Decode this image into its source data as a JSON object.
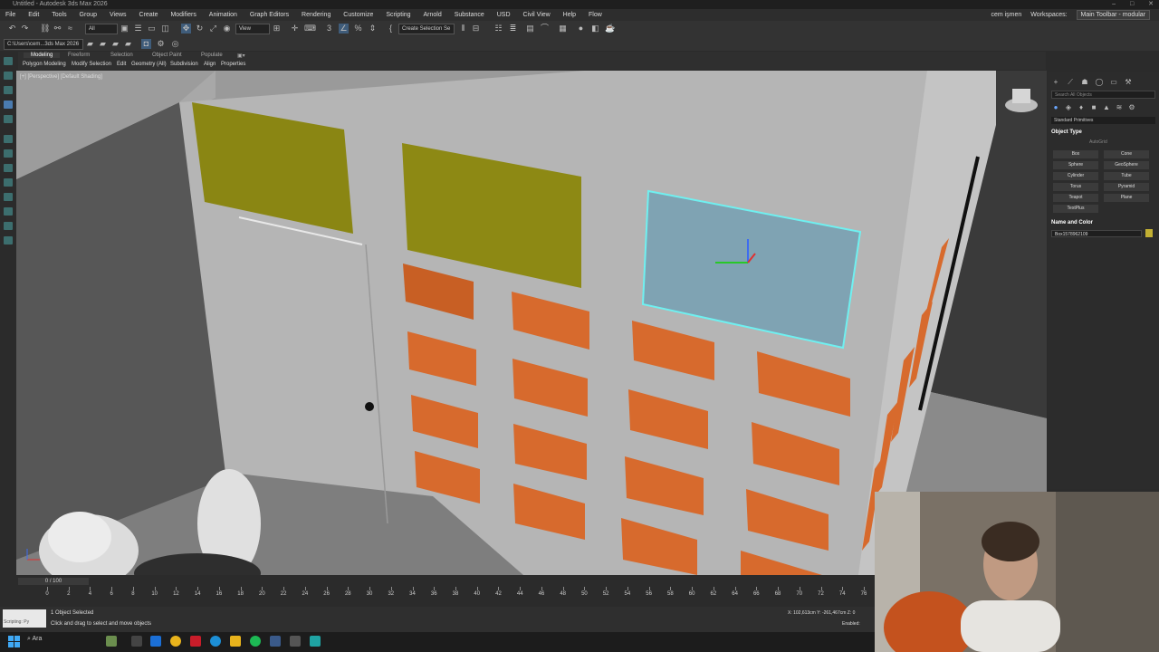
{
  "window": {
    "title": "Untitled - Autodesk 3ds Max 2026",
    "controls": [
      "–",
      "□",
      "✕"
    ]
  },
  "menubar": {
    "items": [
      "File",
      "Edit",
      "Tools",
      "Group",
      "Views",
      "Create",
      "Modifiers",
      "Animation",
      "Graph Editors",
      "Rendering",
      "Customize",
      "Scripting",
      "Arnold",
      "Substance",
      "USD",
      "Civil View",
      "Help",
      "Flow"
    ],
    "user": "cem işmen",
    "workspaces_label": "Workspaces:",
    "workspace_value": "Main Toolbar - modular"
  },
  "toolbar": {
    "selection_filter": "All",
    "ref_coord": "View",
    "named_selection": "Create Selection Se",
    "path": "C:\\Users\\cem...3ds Max 2026"
  },
  "ribbon": {
    "tabs": [
      "Modeling",
      "Freeform",
      "Selection",
      "Object Paint",
      "Populate"
    ],
    "active_tab": "Modeling",
    "subitems": [
      "Polygon Modeling",
      "Modify Selection",
      "Edit",
      "Geometry (All)",
      "Subdivision",
      "Align",
      "Properties"
    ]
  },
  "viewport": {
    "label": "[+] [Perspective] [Default Shading]",
    "selected_color": "#6ff0f0"
  },
  "command_panel": {
    "search_placeholder": "Search All Objects",
    "category": "Standard Primitives",
    "object_type_header": "Object Type",
    "autogrid": "AutoGrid",
    "primitives": [
      "Box",
      "Cone",
      "Sphere",
      "GeoSphere",
      "Cylinder",
      "Tube",
      "Torus",
      "Pyramid",
      "Teapot",
      "Plane",
      "TextPlus"
    ],
    "name_color_header": "Name and Color",
    "object_name": "Box1578962109",
    "object_color": "#c2b033"
  },
  "timeline": {
    "slider": "0 / 100",
    "ticks": [
      0,
      2,
      4,
      6,
      8,
      10,
      12,
      14,
      16,
      18,
      20,
      22,
      24,
      26,
      28,
      30,
      32,
      34,
      36,
      38,
      40,
      42,
      44,
      46,
      48,
      50,
      52,
      54,
      56,
      58,
      60,
      62,
      64,
      66,
      68,
      70,
      72,
      74,
      76
    ]
  },
  "status": {
    "script_label": "Scripting: Py",
    "selection": "1 Object Selected",
    "prompt": "Click and drag to select and move objects",
    "coords": "X: 102,613cm  Y: -261,467cm  Z: 0",
    "enabled": "Enabled:"
  },
  "taskbar": {
    "search": "Ara"
  }
}
